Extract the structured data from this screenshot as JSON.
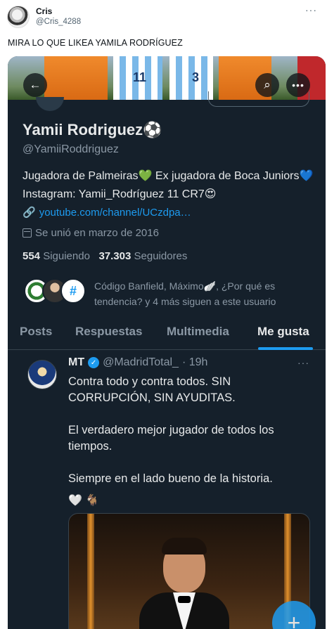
{
  "outer": {
    "author_name": "Cris",
    "author_handle": "@Cris_4288",
    "more_glyph": "···",
    "text": "MIRA LO QUE LIKEA YAMILA RODRÍGUEZ"
  },
  "profile": {
    "banner_numbers": [
      "11",
      "3"
    ],
    "display_name": "Yamii Rodriguez⚽",
    "handle": "@YamiiRoddriguez",
    "bio": "Jugadora de Palmeiras💚 Ex jugadora de Boca Juniors💙 Instagram: Yamii_Rodríguez 11 CR7😍",
    "link": "youtube.com/channel/UCzdpa…",
    "joined": "Se unió en marzo de 2016",
    "following_count": "554",
    "following_label": "Siguiendo",
    "followers_count": "37.303",
    "followers_label": "Seguidores",
    "followed_by_text": "Código Banfield, Máximo🪽, ¿Por qué es tendencia? y 4 más siguen a este usuario",
    "followed_by_badge": "#"
  },
  "tabs": [
    {
      "label": "Posts",
      "active": false
    },
    {
      "label": "Respuestas",
      "active": false
    },
    {
      "label": "Multimedia",
      "active": false
    },
    {
      "label": "Me gusta",
      "active": true
    }
  ],
  "liked_tweet": {
    "name": "MT",
    "handle": "@MadridTotal_",
    "time": "· 19h",
    "more_glyph": "···",
    "text": "Contra todo y contra todos. SIN CORRUPCIÓN, SIN AYUDITAS.\n\nEl verdadero mejor jugador de todos los tiempos.\n\nSiempre en el lado bueno de la historia.",
    "emoji_line": "🤍 🐐"
  },
  "icons": {
    "back": "←",
    "search": "⌕",
    "more": "•••",
    "link": "🔗",
    "verified": "✓",
    "compose": "+"
  },
  "colors": {
    "background": "#15202b",
    "accent": "#1d9bf0",
    "text_primary": "#e7e9ea",
    "text_secondary": "#8b98a5"
  }
}
